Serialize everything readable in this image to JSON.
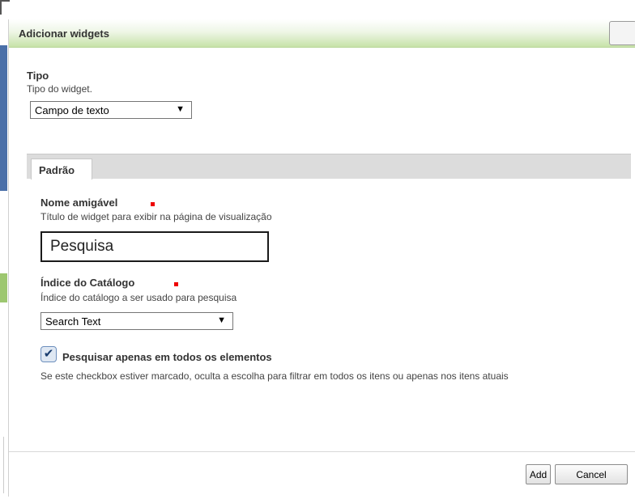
{
  "dialog": {
    "title": "Adicionar widgets"
  },
  "tipo": {
    "label": "Tipo",
    "description": "Tipo do widget.",
    "selected": "Campo de texto"
  },
  "tabs": [
    {
      "label": "Padrão"
    }
  ],
  "nome_amigavel": {
    "label": "Nome amigável",
    "description": "Título de widget para exibir na página de visualização",
    "value": "Pesquisa"
  },
  "indice_catalogo": {
    "label": "Índice do Catálogo",
    "description": "Índice do catálogo a ser usado para pesquisa",
    "selected": "Search Text"
  },
  "pesquisar_todos": {
    "label": "Pesquisar apenas em todos os elementos",
    "checked": true,
    "description": "Se este checkbox estiver marcado, oculta a escolha para filtrar em todos os itens ou apenas nos itens atuais"
  },
  "footer": {
    "add_label": "Add",
    "cancel_label": "Cancel"
  },
  "colors": {
    "title_gradient_end": "#c7e2a8",
    "required_marker": "#e00000",
    "side_bar": "#4a6fa8"
  }
}
